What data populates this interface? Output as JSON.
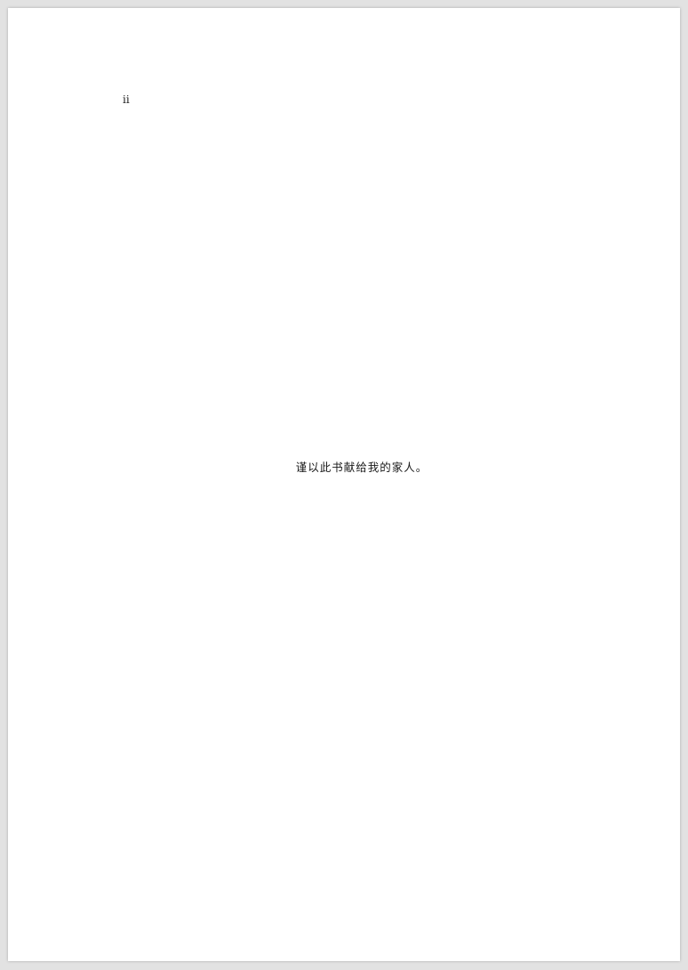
{
  "page": {
    "number": "ii",
    "dedication": "谨以此书献给我的家人。"
  }
}
